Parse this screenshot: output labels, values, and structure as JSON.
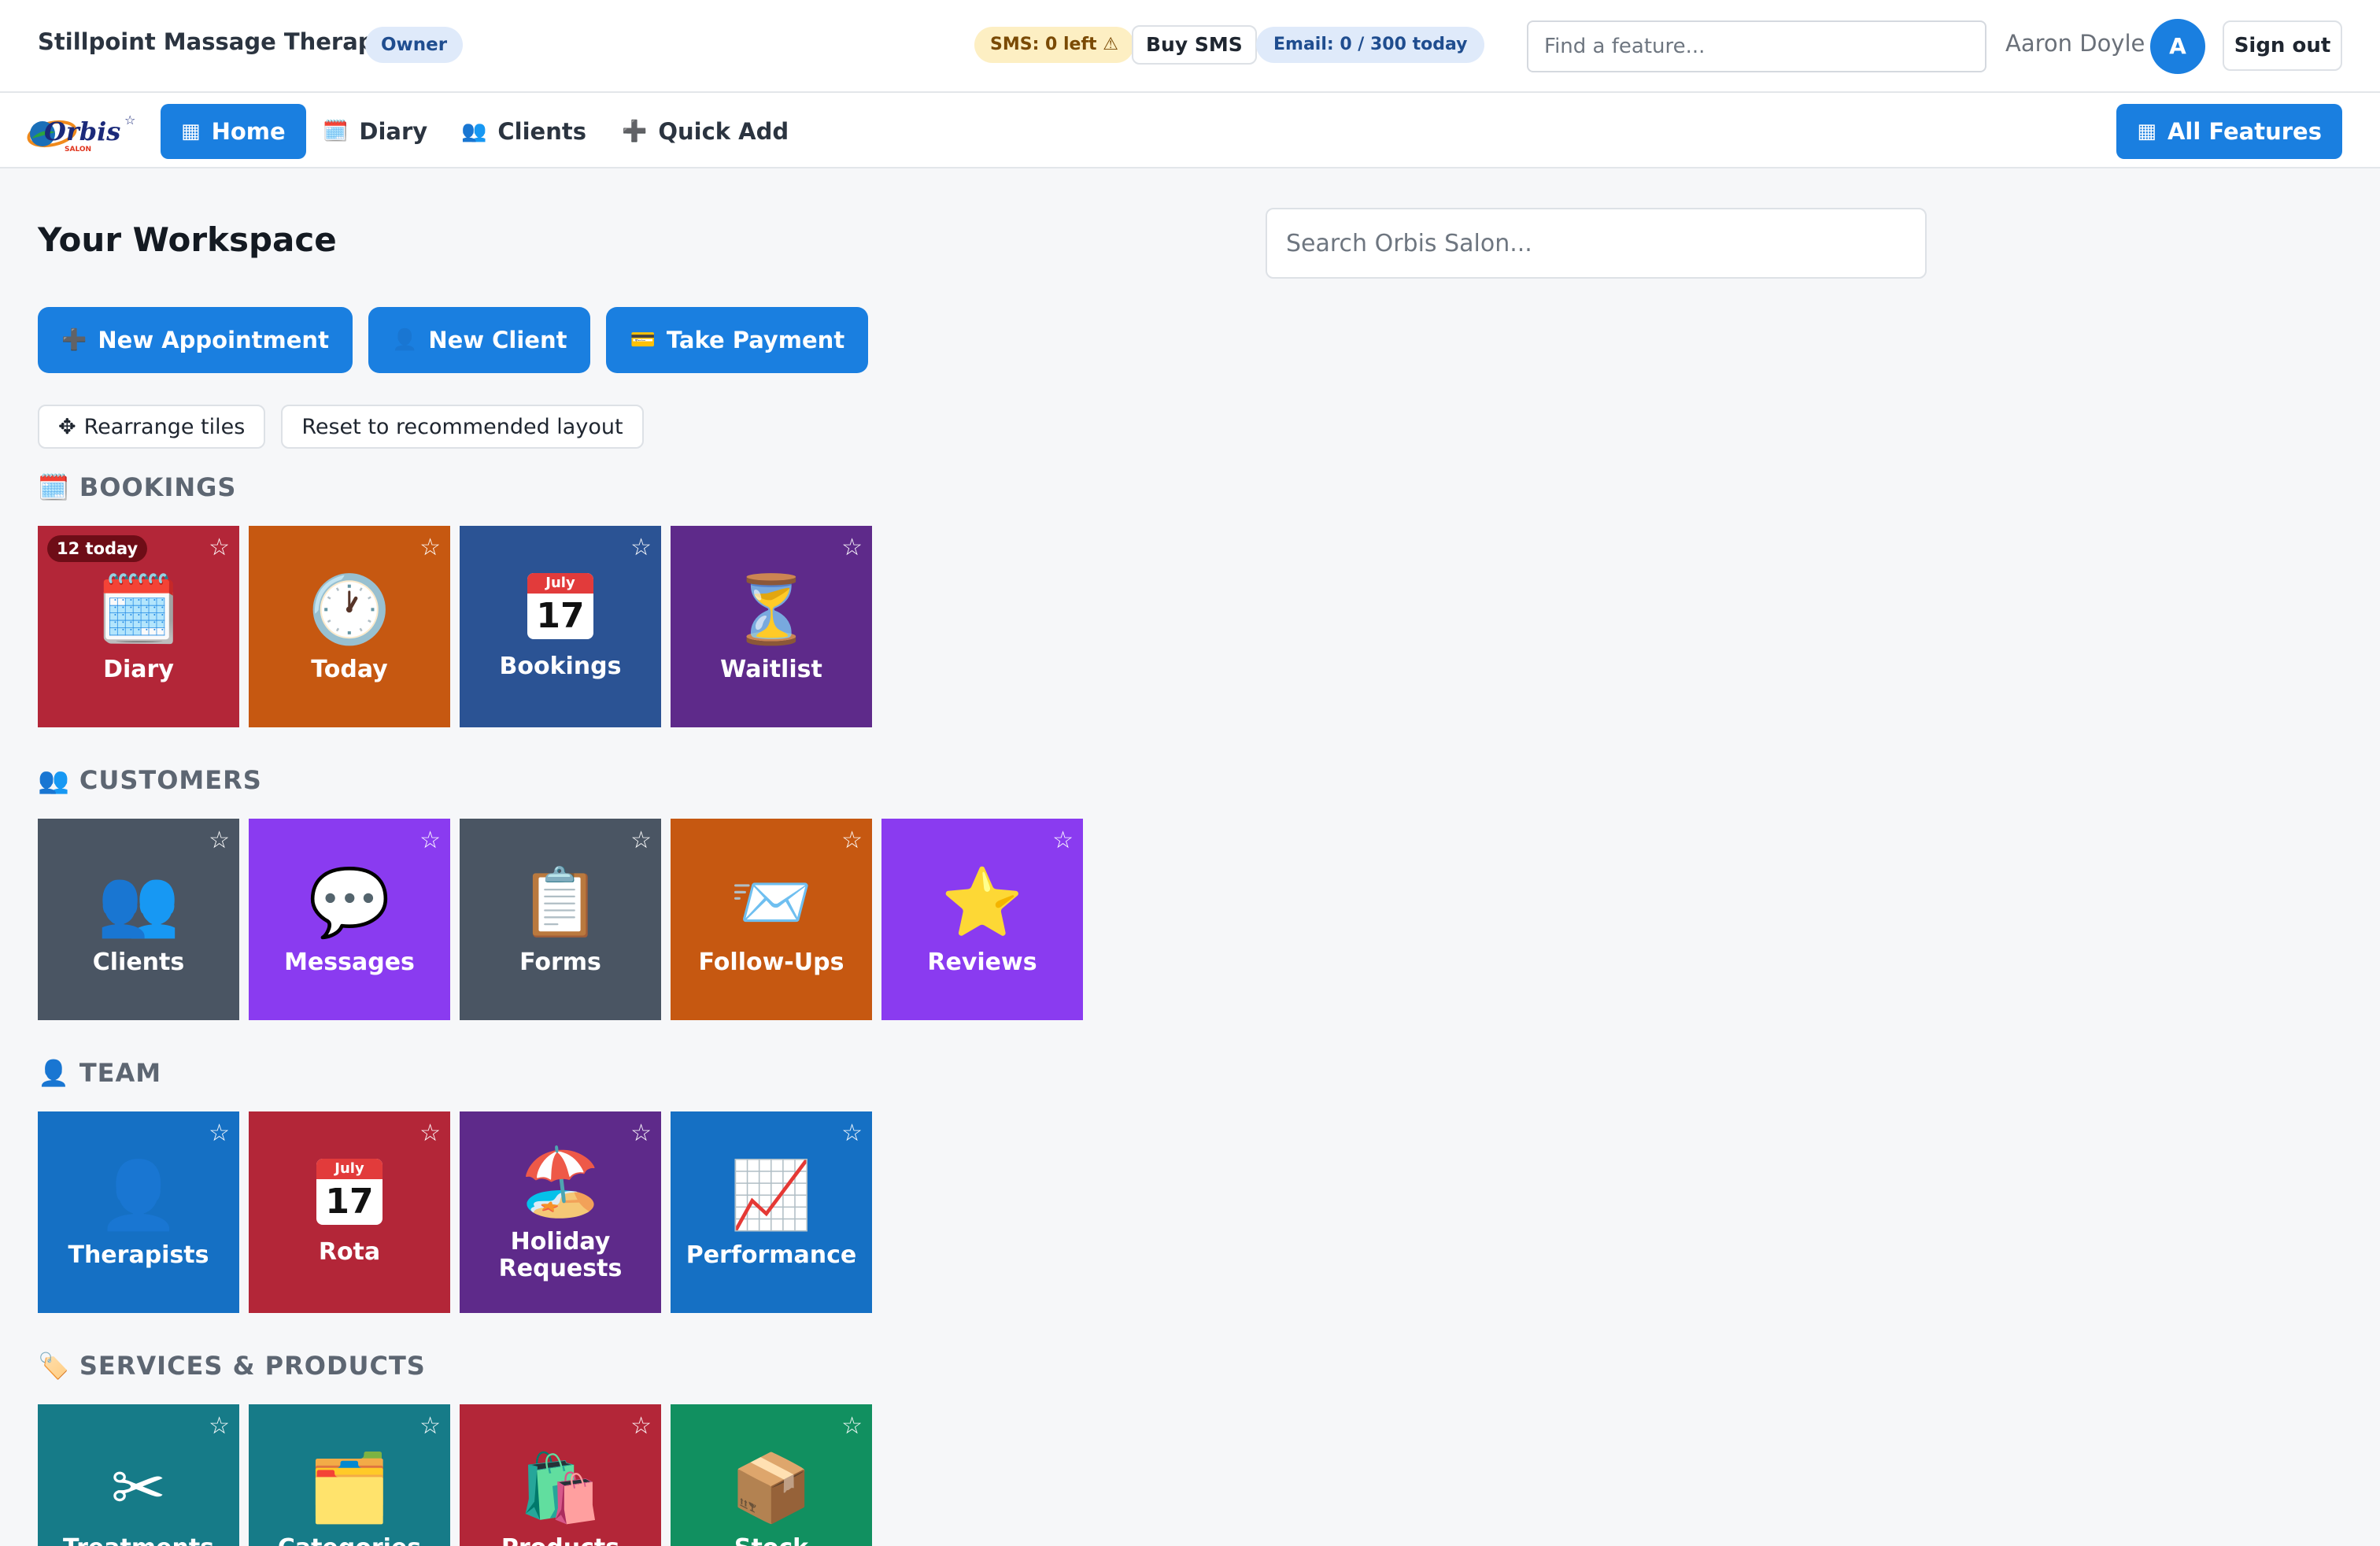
{
  "header": {
    "business_name": "Stillpoint Massage Therapy",
    "role_badge": "Owner",
    "sms_status": "SMS: 0 left ⚠",
    "buy_sms": "Buy SMS",
    "email_status": "Email: 0 / 300 today",
    "feature_search_placeholder": "Find a feature...",
    "user_name": "Aaron Doyle",
    "avatar_initial": "A",
    "sign_out": "Sign out"
  },
  "nav": {
    "logo_text": "Orbis",
    "logo_sub": "SALON",
    "items": [
      {
        "label": "Home",
        "icon": "▦"
      },
      {
        "label": "Diary",
        "icon": "🗓️"
      },
      {
        "label": "Clients",
        "icon": "👥"
      },
      {
        "label": "Quick Add",
        "icon": "➕"
      }
    ],
    "all_features": "All Features",
    "all_features_icon": "▦"
  },
  "main": {
    "title": "Your Workspace",
    "search_placeholder": "Search Orbis Salon...",
    "quick_actions": [
      {
        "label": "New Appointment",
        "icon": "➕"
      },
      {
        "label": "New Client",
        "icon": "👤"
      },
      {
        "label": "Take Payment",
        "icon": "💳"
      }
    ],
    "rearrange": "Rearrange tiles",
    "rearrange_icon": "✥",
    "reset_layout": "Reset to recommended layout"
  },
  "sections": [
    {
      "title": "BOOKINGS",
      "icon": "🗓️",
      "tiles": [
        {
          "label": "Diary",
          "icon": "🗓️",
          "color": "#b32638",
          "badge": "12 today"
        },
        {
          "label": "Today",
          "icon": "🕐",
          "color": "#c65811"
        },
        {
          "label": "Bookings",
          "icon": "calendar",
          "cal_month": "July",
          "cal_day": "17",
          "color": "#2b5394"
        },
        {
          "label": "Waitlist",
          "icon": "⏳",
          "color": "#5e2a8a"
        }
      ]
    },
    {
      "title": "CUSTOMERS",
      "icon": "👥",
      "tiles": [
        {
          "label": "Clients",
          "icon": "👥",
          "color": "#4a5563"
        },
        {
          "label": "Messages",
          "icon": "💬",
          "color": "#8a3bf0"
        },
        {
          "label": "Forms",
          "icon": "📋",
          "color": "#4a5563"
        },
        {
          "label": "Follow-Ups",
          "icon": "📨",
          "color": "#c65811"
        },
        {
          "label": "Reviews",
          "icon": "⭐",
          "color": "#8a3bf0"
        }
      ]
    },
    {
      "title": "TEAM",
      "icon": "👤",
      "tiles": [
        {
          "label": "Therapists",
          "icon": "👤",
          "color": "#1570c4"
        },
        {
          "label": "Rota",
          "icon": "calendar",
          "cal_month": "July",
          "cal_day": "17",
          "color": "#b32638"
        },
        {
          "label": "Holiday Requests",
          "icon": "🏖️",
          "color": "#5e2a8a"
        },
        {
          "label": "Performance",
          "icon": "📈",
          "color": "#1570c4"
        }
      ]
    },
    {
      "title": "SERVICES & PRODUCTS",
      "icon": "🏷️",
      "tiles": [
        {
          "label": "Treatments",
          "icon": "✂",
          "color": "#167b88"
        },
        {
          "label": "Categories",
          "icon": "🗂️",
          "color": "#167b88"
        },
        {
          "label": "Products",
          "icon": "🛍️",
          "color": "#b32638"
        },
        {
          "label": "Stock",
          "icon": "📦",
          "color": "#119060"
        }
      ]
    }
  ],
  "tile_star": "☆"
}
